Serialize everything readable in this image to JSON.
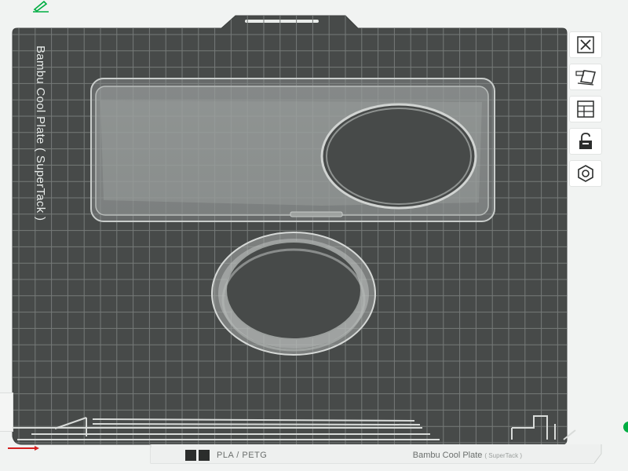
{
  "plate": {
    "label_vertical": "Bambu Cool Plate ( SuperTack )",
    "filament": "PLA / PETG",
    "name": "Bambu Cool Plate",
    "name_sub": "( SuperTack )"
  },
  "toolbar": {
    "items": [
      {
        "id": "close",
        "icon": "close-icon"
      },
      {
        "id": "auto-orient",
        "icon": "auto-orient-icon"
      },
      {
        "id": "arrange",
        "icon": "arrange-icon"
      },
      {
        "id": "lock",
        "icon": "unlock-icon"
      },
      {
        "id": "settings",
        "icon": "hex-nut-icon"
      }
    ]
  },
  "colors": {
    "plate_dark": "#474a49",
    "grid": "#767a79",
    "accent_green": "#00ae42",
    "axis_red": "#d42020",
    "toolbar_bg": "#ffffff"
  }
}
